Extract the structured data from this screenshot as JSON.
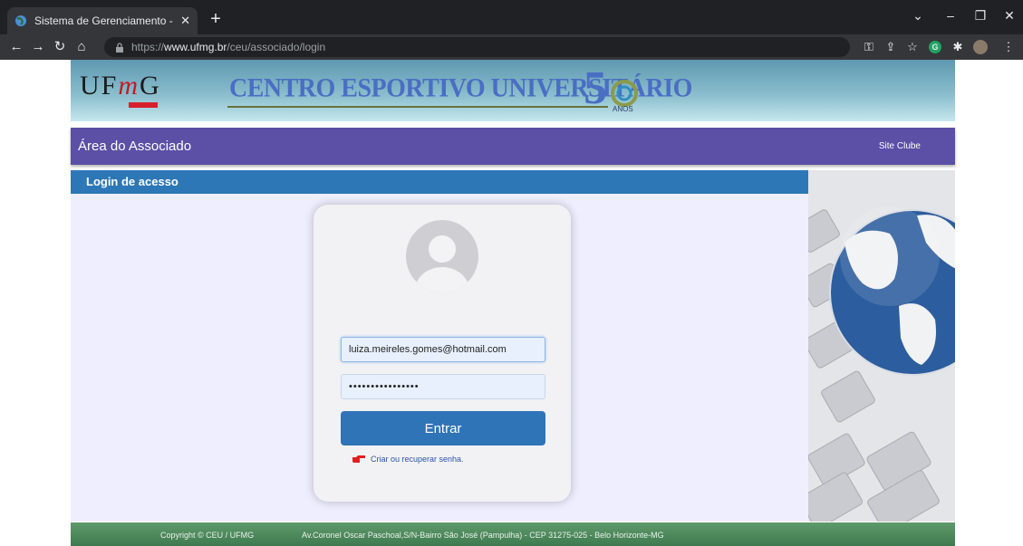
{
  "browser": {
    "tab_title": "Sistema de Gerenciamento - CEU",
    "tab_close": "✕",
    "new_tab": "+",
    "url_prefix": "https://",
    "url_host": "www.ufmg.br",
    "url_path": "/ceu/associado/login",
    "profile_initial": "G"
  },
  "banner": {
    "logo_text_pre": "UF",
    "logo_text_m": "m",
    "logo_text_post": "G",
    "title": "CENTRO ESPORTIVO UNIVERSITÁRIO",
    "fifty": "5",
    "anos": "ANOS"
  },
  "nav": {
    "area_title": "Área do Associado",
    "site_clube": "Site Clube"
  },
  "login": {
    "header": "Login de acesso",
    "email_value": "luiza.meireles.gomes@hotmail.com",
    "password_value": "••••••••••••••••",
    "submit_label": "Entrar",
    "recover_link": "Criar ou recuperar senha."
  },
  "footer": {
    "copyright": "Copyright © CEU / UFMG",
    "address": "Av.Coronel Oscar Paschoal,S/N-Bairro São José (Pampulha) - CEP 31275-025 - Belo Horizonte-MG"
  },
  "colors": {
    "purple_bar": "#5b4fa6",
    "login_header": "#2d77b6",
    "submit_button": "#3074b8",
    "footer": "#4f8a5d"
  }
}
